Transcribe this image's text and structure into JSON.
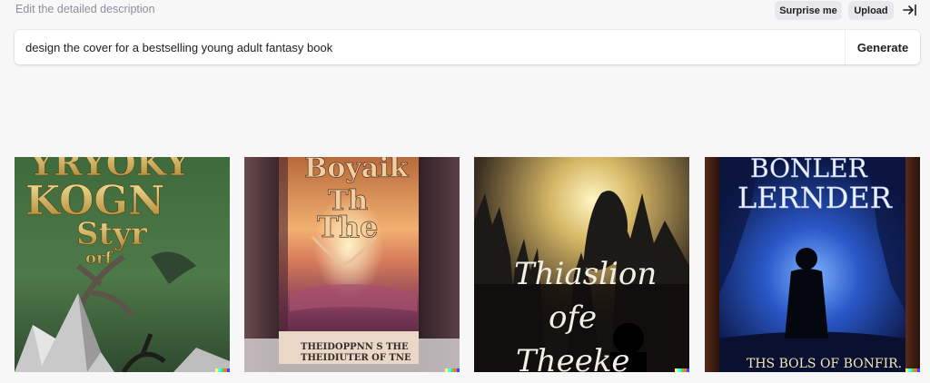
{
  "header": {
    "hint": "Edit the detailed description",
    "surprise_label": "Surprise me",
    "upload_label": "Upload",
    "collapse_icon": "arrow-right-to-line-icon"
  },
  "prompt": {
    "value": "design the cover for a bestselling young adult fantasy book",
    "generate_label": "Generate"
  },
  "results": [
    {
      "title_lines": [
        "YRYOKY",
        "KOGN",
        "Styr",
        "orf"
      ],
      "palette": "green"
    },
    {
      "title_lines": [
        "Boyaik",
        "Th",
        "The"
      ],
      "bottom_lines": [
        "THEIDOPPNN S THE",
        "THEIDIUTER OF TNE"
      ],
      "palette": "sunset"
    },
    {
      "title_lines": [
        "Thiaslion",
        "ofe",
        "Theeke"
      ],
      "palette": "forest-night"
    },
    {
      "title_lines": [
        "BONLER",
        "LERNDER"
      ],
      "bottom_lines": [
        "THS BOLS OF BONFIR."
      ],
      "palette": "blue-cave"
    }
  ],
  "colors": {
    "background": "#f7f7f8",
    "accent_text": "#202123",
    "muted_text": "#8e8ea0"
  }
}
